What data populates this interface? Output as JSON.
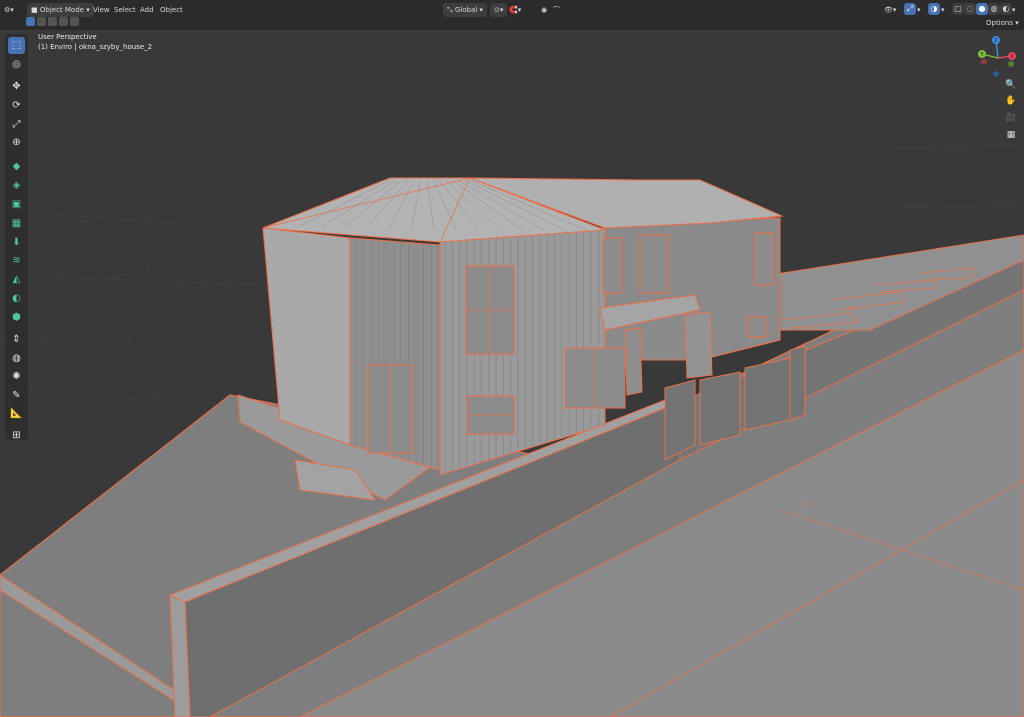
{
  "header": {
    "mode": "Object Mode",
    "menus": [
      "View",
      "Select",
      "Add",
      "Object"
    ],
    "transform_orientation": "Global",
    "options_label": "Options",
    "accent_color": "#4772b3"
  },
  "viewport": {
    "view_name": "User Perspective",
    "object_label": "(1) Enviro | okna_szyby_house_2",
    "selection_color": "#e8704a",
    "mesh_color": "#8f8f8f"
  },
  "gizmo": {
    "axes": [
      "Z",
      "Y",
      "X"
    ],
    "colors": {
      "x": "#e5455a",
      "y": "#7fbf3f",
      "z": "#3d8ee8"
    }
  },
  "tools": [
    {
      "name": "select-box-tool",
      "glyph": "⬚",
      "active": true
    },
    {
      "name": "cursor-tool",
      "glyph": "◎"
    },
    {
      "name": "move-tool",
      "glyph": "✥"
    },
    {
      "name": "rotate-tool",
      "glyph": "⟳"
    },
    {
      "name": "scale-tool",
      "glyph": "⤢"
    },
    {
      "name": "transform-tool",
      "glyph": "⊕"
    },
    {
      "name": "add-cube-tool",
      "glyph": "◆",
      "green": true
    },
    {
      "name": "extrude-region-tool",
      "glyph": "◈",
      "green": true
    },
    {
      "name": "inset-faces-tool",
      "glyph": "▣",
      "green": true
    },
    {
      "name": "bevel-tool",
      "glyph": "▦",
      "green": true
    },
    {
      "name": "loop-cut-tool",
      "glyph": "⬇",
      "green": true
    },
    {
      "name": "knife-tool",
      "glyph": "≋",
      "green": true
    },
    {
      "name": "poly-build-tool",
      "glyph": "◭",
      "green": true
    },
    {
      "name": "spin-tool",
      "glyph": "◐",
      "green": true
    },
    {
      "name": "smooth-tool",
      "glyph": "⬢",
      "green": true
    },
    {
      "name": "edge-slide-tool",
      "glyph": "⇕"
    },
    {
      "name": "shrink-fatten-tool",
      "glyph": "◍"
    },
    {
      "name": "shear-tool",
      "glyph": "✺"
    },
    {
      "name": "annotate-tool",
      "glyph": "✎"
    },
    {
      "name": "measure-tool",
      "glyph": "📐"
    },
    {
      "name": "add-object-tool",
      "glyph": "⊞"
    }
  ],
  "nav_icons": [
    {
      "name": "zoom-icon",
      "glyph": "🔍"
    },
    {
      "name": "pan-hand-icon",
      "glyph": "✋"
    },
    {
      "name": "camera-view-icon",
      "glyph": "🎥"
    },
    {
      "name": "grid-view-icon",
      "glyph": "▦"
    }
  ]
}
